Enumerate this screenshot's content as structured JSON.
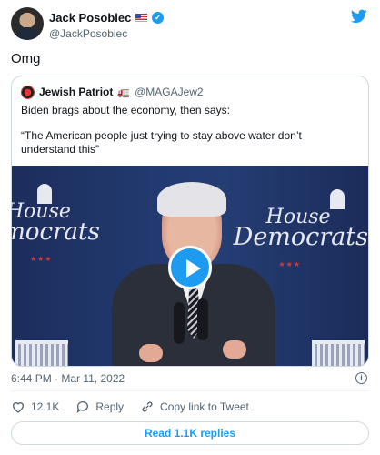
{
  "author": {
    "name": "Jack Posobiec",
    "handle": "@JackPosobiec"
  },
  "tweet": {
    "text": "Omg"
  },
  "quoted": {
    "name": "Jewish Patriot",
    "handle": "@MAGAJew2",
    "line1": "Biden brags about the economy, then says:",
    "line2": "“The American people just trying to stay above water don’t understand this”",
    "video": {
      "logo_word1": "House",
      "logo_word2": "Democrats"
    }
  },
  "meta": {
    "timestamp": "6:44 PM · Mar 11, 2022"
  },
  "actions": {
    "like_count": "12.1K",
    "reply_label": "Reply",
    "copy_label": "Copy link to Tweet"
  },
  "replies_button": "Read 1.1K replies",
  "colors": {
    "accent": "#1d9bf0",
    "muted": "#536471",
    "border": "#cfd9de"
  },
  "icons": [
    "twitter-bird-icon",
    "verified-icon",
    "us-flag-icon",
    "truck-icon",
    "play-icon",
    "info-icon",
    "heart-icon",
    "reply-icon",
    "link-icon"
  ]
}
